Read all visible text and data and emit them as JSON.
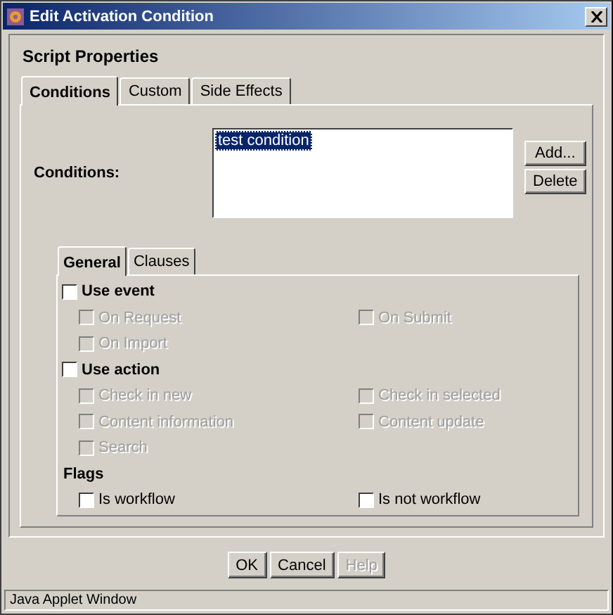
{
  "window": {
    "title": "Edit Activation Condition"
  },
  "heading": "Script Properties",
  "tabs": [
    {
      "label": "Conditions",
      "selected": true
    },
    {
      "label": "Custom",
      "selected": false
    },
    {
      "label": "Side Effects",
      "selected": false
    }
  ],
  "conditions": {
    "label": "Conditions:",
    "items": [
      {
        "text": "test condition",
        "selected": true
      }
    ],
    "buttons": [
      "Add...",
      "Delete"
    ]
  },
  "inner_tabs": [
    {
      "label": "General",
      "selected": true
    },
    {
      "label": "Clauses",
      "selected": false
    }
  ],
  "options": [
    {
      "kind": "master",
      "label": "Use event",
      "checked": false,
      "disabled": false
    },
    {
      "kind": "option",
      "label": "On Request",
      "checked": false,
      "disabled": true
    },
    {
      "kind": "option",
      "label": "On Submit",
      "checked": false,
      "disabled": true
    },
    {
      "kind": "option",
      "label": "On Import",
      "checked": false,
      "disabled": true
    },
    {
      "kind": "master",
      "label": "Use action",
      "checked": false,
      "disabled": false
    },
    {
      "kind": "option",
      "label": "Check in new",
      "checked": false,
      "disabled": true
    },
    {
      "kind": "option",
      "label": "Check in selected",
      "checked": false,
      "disabled": true
    },
    {
      "kind": "option",
      "label": "Content information",
      "checked": false,
      "disabled": true
    },
    {
      "kind": "option",
      "label": "Content update",
      "checked": false,
      "disabled": true
    },
    {
      "kind": "option",
      "label": "Search",
      "checked": false,
      "disabled": true
    },
    {
      "kind": "heading",
      "label": "Flags"
    },
    {
      "kind": "option",
      "label": "Is workflow",
      "checked": false,
      "disabled": false
    },
    {
      "kind": "option",
      "label": "Is not workflow",
      "checked": false,
      "disabled": false
    }
  ],
  "buttons": [
    {
      "label": "OK",
      "disabled": false
    },
    {
      "label": "Cancel",
      "disabled": false
    },
    {
      "label": "Help",
      "disabled": true
    }
  ],
  "status_bar": "Java Applet Window"
}
